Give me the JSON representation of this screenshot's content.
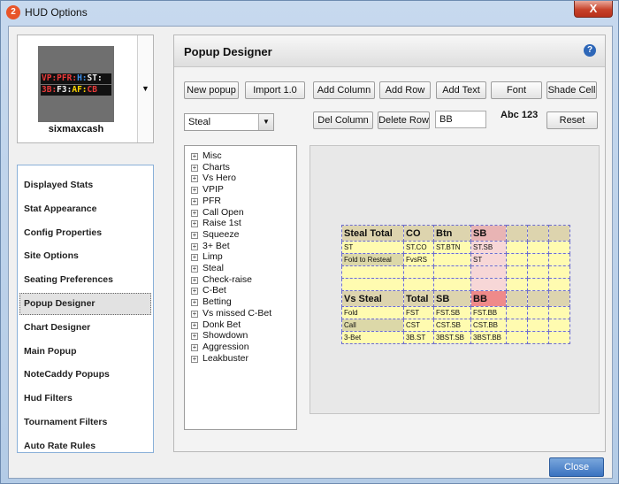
{
  "window": {
    "title": "HUD Options",
    "app_icon_glyph": "2",
    "close_glyph": "X"
  },
  "profile": {
    "name": "sixmaxcash",
    "hud_lines": [
      {
        "segments": [
          {
            "text": "VP:",
            "color": "#e83a3a"
          },
          {
            "text": "PFR:",
            "color": "#e83a3a"
          },
          {
            "text": "H:",
            "color": "#3f8fe8"
          },
          {
            "text": "ST:",
            "color": "#f0f0f0"
          }
        ]
      },
      {
        "segments": [
          {
            "text": "3B:",
            "color": "#e83a3a"
          },
          {
            "text": "F3:",
            "color": "#f0f0f0"
          },
          {
            "text": "AF:",
            "color": "#ffd600"
          },
          {
            "text": "CB",
            "color": "#e83a3a"
          }
        ]
      }
    ],
    "dropdown_glyph": "▼"
  },
  "nav": {
    "items": [
      "Displayed Stats",
      "Stat Appearance",
      "Config Properties",
      "Site Options",
      "Seating Preferences",
      "Popup Designer",
      "Chart Designer",
      "Main Popup",
      "NoteCaddy Popups",
      "Hud Filters",
      "Tournament Filters",
      "Auto Rate Rules"
    ],
    "active": "Popup Designer"
  },
  "panel": {
    "title": "Popup Designer",
    "help_glyph": "?",
    "buttons": {
      "new_popup": "New popup",
      "import": "Import 1.0",
      "add_column": "Add Column",
      "add_row": "Add Row",
      "add_text": "Add Text",
      "font": "Font",
      "shade_cell": "Shade Cell",
      "del_column": "Del Column",
      "delete_row": "Delete Row",
      "reset": "Reset"
    },
    "stat_select": {
      "value": "Steal",
      "arrow": "▼"
    },
    "text_field": {
      "value": "BB"
    },
    "font_sample": "Abc 123",
    "tree": {
      "expander": "+",
      "items": [
        "Misc",
        "Charts",
        "Vs Hero",
        "VPIP",
        "PFR",
        "Call Open",
        "Raise 1st",
        "Squeeze",
        "3+ Bet",
        "Limp",
        "Steal",
        "Check-raise",
        "C-Bet",
        "Betting",
        "Vs missed C-Bet",
        "Donk Bet",
        "Showdown",
        "Aggression",
        "Leakbuster"
      ]
    },
    "grid": {
      "rows": [
        {
          "type": "header",
          "cells": [
            {
              "t": "Steal Total",
              "c": "hdr"
            },
            {
              "t": "CO",
              "c": "hdr"
            },
            {
              "t": "Btn",
              "c": "hdr"
            },
            {
              "t": "SB",
              "c": "hdr hdr-pink"
            },
            {
              "t": "",
              "c": "hdr"
            },
            {
              "t": "",
              "c": "hdr"
            },
            {
              "t": "",
              "c": "hdr"
            }
          ]
        },
        {
          "type": "data",
          "cells": [
            {
              "t": "ST",
              "c": ""
            },
            {
              "t": "ST.CO",
              "c": ""
            },
            {
              "t": "ST.BTN",
              "c": ""
            },
            {
              "t": "ST.SB",
              "c": "pink"
            },
            {
              "t": "",
              "c": ""
            },
            {
              "t": "",
              "c": ""
            },
            {
              "t": "",
              "c": ""
            }
          ]
        },
        {
          "type": "data",
          "cells": [
            {
              "t": "Fold to Resteal",
              "c": "olive"
            },
            {
              "t": "FvsRS",
              "c": ""
            },
            {
              "t": "",
              "c": ""
            },
            {
              "t": "ST",
              "c": "pink"
            },
            {
              "t": "",
              "c": ""
            },
            {
              "t": "",
              "c": ""
            },
            {
              "t": "",
              "c": ""
            }
          ]
        },
        {
          "type": "data",
          "cells": [
            {
              "t": "",
              "c": ""
            },
            {
              "t": "",
              "c": ""
            },
            {
              "t": "",
              "c": ""
            },
            {
              "t": "",
              "c": "pink"
            },
            {
              "t": "",
              "c": ""
            },
            {
              "t": "",
              "c": ""
            },
            {
              "t": "",
              "c": ""
            }
          ]
        },
        {
          "type": "data",
          "cells": [
            {
              "t": "",
              "c": ""
            },
            {
              "t": "",
              "c": ""
            },
            {
              "t": "",
              "c": ""
            },
            {
              "t": "",
              "c": "pink"
            },
            {
              "t": "",
              "c": ""
            },
            {
              "t": "",
              "c": ""
            },
            {
              "t": "",
              "c": ""
            }
          ]
        },
        {
          "type": "header",
          "cells": [
            {
              "t": "Vs Steal",
              "c": "hdr"
            },
            {
              "t": "Total",
              "c": "hdr"
            },
            {
              "t": "SB",
              "c": "hdr"
            },
            {
              "t": "BB",
              "c": "hdr red"
            },
            {
              "t": "",
              "c": "hdr"
            },
            {
              "t": "",
              "c": "hdr"
            },
            {
              "t": "",
              "c": "hdr"
            }
          ]
        },
        {
          "type": "data",
          "cells": [
            {
              "t": "Fold",
              "c": ""
            },
            {
              "t": "FST",
              "c": ""
            },
            {
              "t": "FST.SB",
              "c": ""
            },
            {
              "t": "FST.BB",
              "c": ""
            },
            {
              "t": "",
              "c": ""
            },
            {
              "t": "",
              "c": ""
            },
            {
              "t": "",
              "c": ""
            }
          ]
        },
        {
          "type": "data",
          "cells": [
            {
              "t": "Call",
              "c": "olive"
            },
            {
              "t": "CST",
              "c": ""
            },
            {
              "t": "CST.SB",
              "c": ""
            },
            {
              "t": "CST.BB",
              "c": ""
            },
            {
              "t": "",
              "c": ""
            },
            {
              "t": "",
              "c": ""
            },
            {
              "t": "",
              "c": ""
            }
          ]
        },
        {
          "type": "data",
          "cells": [
            {
              "t": "3-Bet",
              "c": ""
            },
            {
              "t": "3B.ST",
              "c": ""
            },
            {
              "t": "3BST.SB",
              "c": ""
            },
            {
              "t": "3BST.BB",
              "c": ""
            },
            {
              "t": "",
              "c": ""
            },
            {
              "t": "",
              "c": ""
            },
            {
              "t": "",
              "c": ""
            }
          ]
        }
      ]
    }
  },
  "footer": {
    "close": "Close"
  }
}
